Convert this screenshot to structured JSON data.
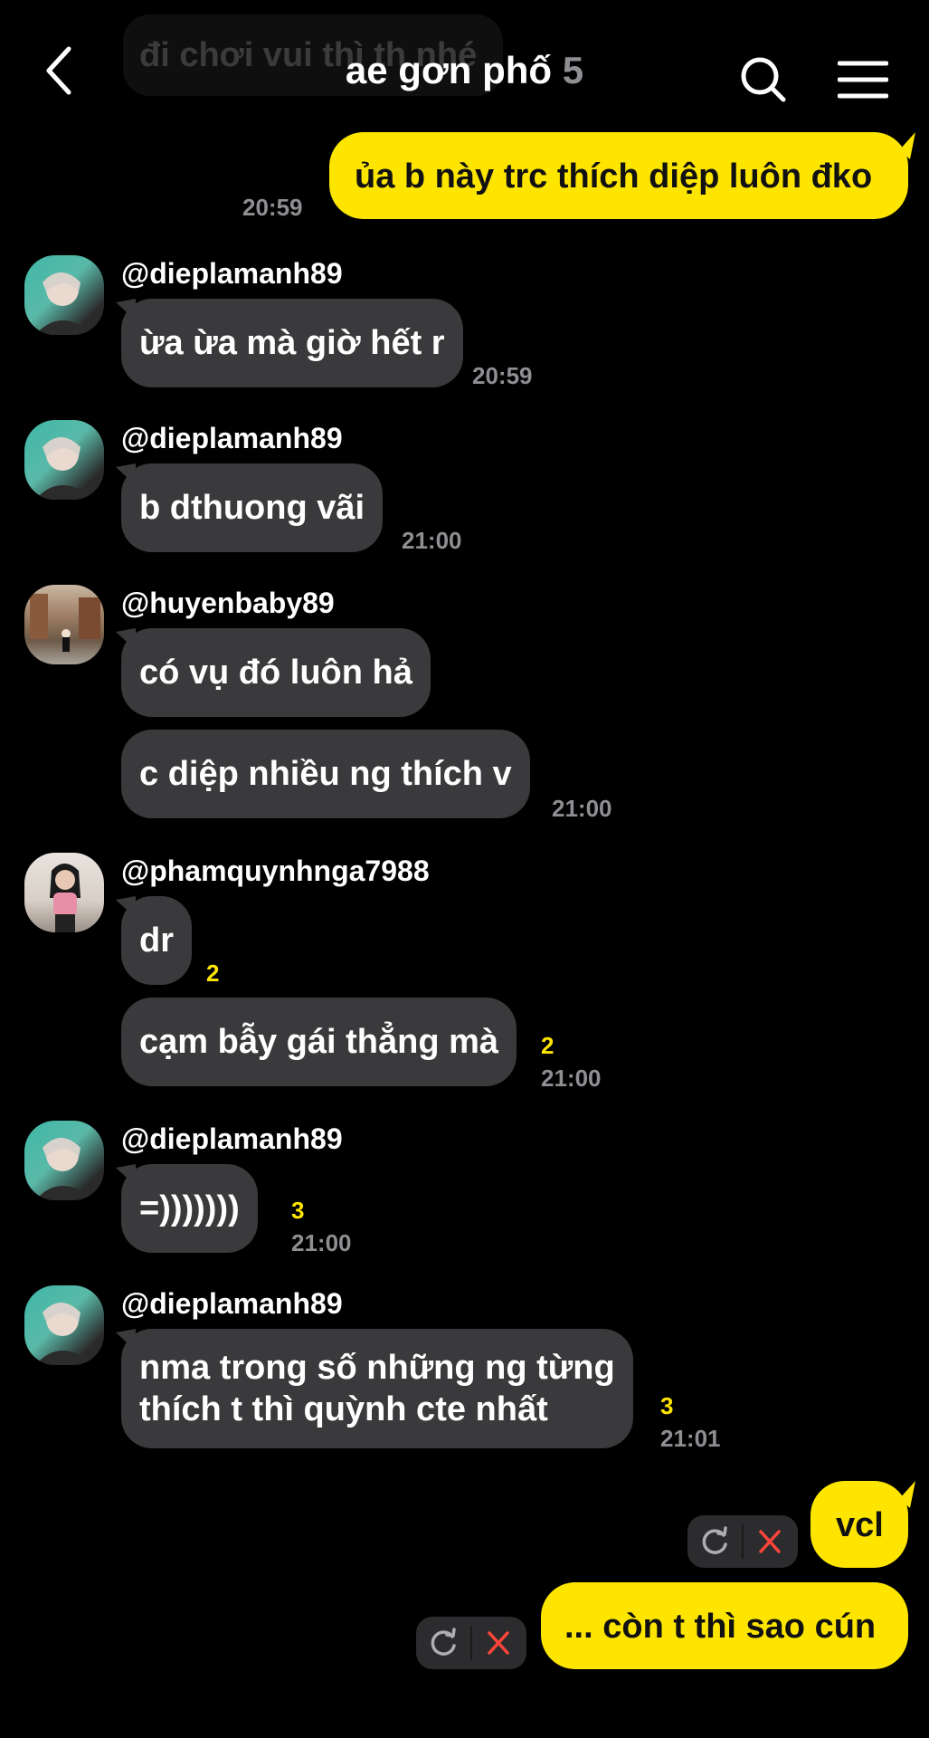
{
  "header": {
    "back_icon": "chevron-left-icon",
    "title": "ae gơn phố",
    "member_count": "5",
    "search_icon": "search-icon",
    "menu_icon": "hamburger-menu-icon",
    "behind_text": "đi chơi vui thì th nhé"
  },
  "colors": {
    "background": "#000000",
    "incoming_bubble": "#3a3a3c",
    "outgoing_bubble": "#fee500",
    "timestamp": "#8e8e93",
    "unread": "#fee500",
    "error_x": "#ff453a"
  },
  "messages": {
    "m1": {
      "text": "ủa b này trc thích diệp luôn đko",
      "time": "20:59"
    },
    "g1": {
      "sender": "@dieplamanh89",
      "text": "ừa ừa mà giờ hết r",
      "time": "20:59"
    },
    "g2": {
      "sender": "@dieplamanh89",
      "text": "b dthuong vãi",
      "time": "21:00"
    },
    "g3": {
      "sender": "@huyenbaby89",
      "text1": "có vụ đó luôn hả",
      "text2": "c diệp nhiều ng thích v",
      "time": "21:00"
    },
    "g4": {
      "sender": "@phamquynhnga7988",
      "text1": "dr",
      "unread1": "2",
      "text2": "cạm bẫy gái thẳng mà",
      "unread2": "2",
      "time": "21:00"
    },
    "g5": {
      "sender": "@dieplamanh89",
      "text": "=)))))))",
      "unread": "3",
      "time": "21:00"
    },
    "g6": {
      "sender": "@dieplamanh89",
      "line1": "nma trong số những ng từng",
      "line2": "thích t thì quỳnh cte nhất",
      "unread": "3",
      "time": "21:01"
    },
    "out2": {
      "text": "vcl",
      "retry_icon": "refresh-icon",
      "delete_icon": "close-x-icon"
    },
    "out3": {
      "text": "... còn t thì sao cún",
      "retry_icon": "refresh-icon",
      "delete_icon": "close-x-icon"
    }
  }
}
